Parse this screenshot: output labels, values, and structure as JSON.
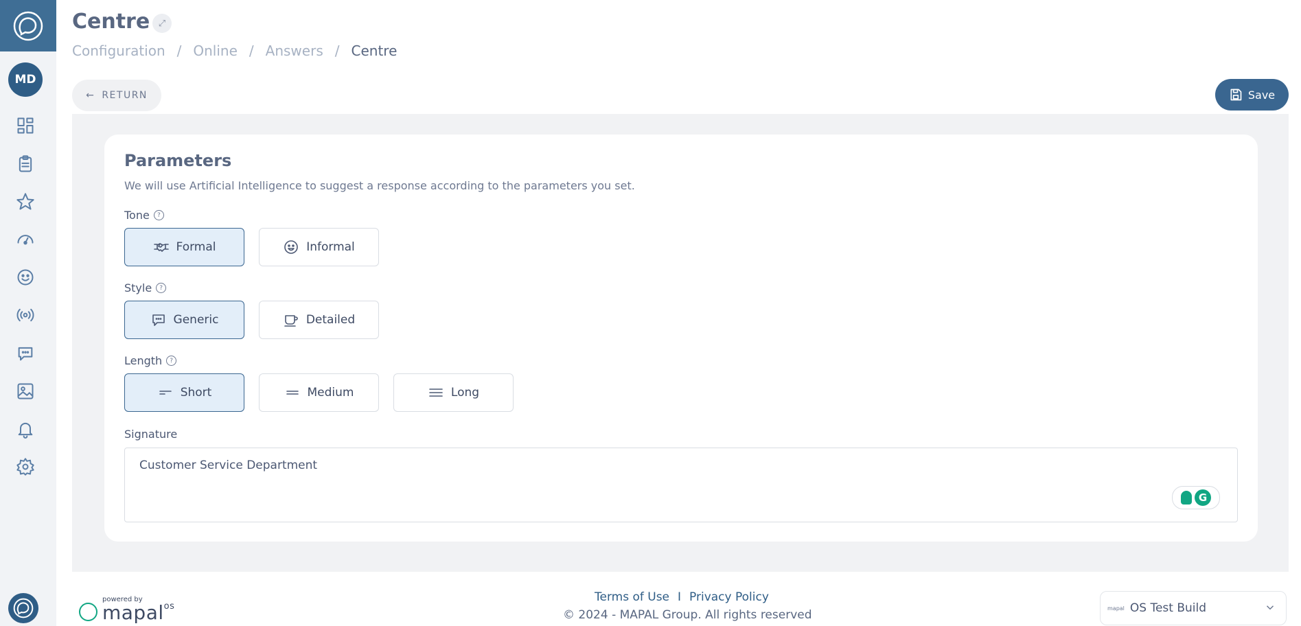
{
  "header": {
    "title": "Centre",
    "expand_icon": "expand-icon",
    "breadcrumb": [
      "Configuration",
      "Online",
      "Answers",
      "Centre"
    ],
    "breadcrumb_separator": "/"
  },
  "sidebar": {
    "avatar_initials": "MD",
    "items": [
      {
        "icon": "dashboard-icon"
      },
      {
        "icon": "clipboard-icon"
      },
      {
        "icon": "star-icon"
      },
      {
        "icon": "gauge-icon"
      },
      {
        "icon": "smiley-icon"
      },
      {
        "icon": "broadcast-icon"
      },
      {
        "icon": "chat-icon"
      },
      {
        "icon": "image-icon"
      },
      {
        "icon": "bell-icon"
      },
      {
        "icon": "gear-icon"
      }
    ]
  },
  "toolbar": {
    "return_label": "RETURN",
    "save_label": "Save"
  },
  "parameters": {
    "title": "Parameters",
    "description": "We will use Artificial Intelligence to suggest a response according to the parameters you set.",
    "tone": {
      "label": "Tone",
      "options": [
        {
          "label": "Formal",
          "icon": "handshake-icon",
          "selected": true
        },
        {
          "label": "Informal",
          "icon": "smiley-icon",
          "selected": false
        }
      ]
    },
    "style": {
      "label": "Style",
      "options": [
        {
          "label": "Generic",
          "icon": "chat-icon",
          "selected": true
        },
        {
          "label": "Detailed",
          "icon": "cup-icon",
          "selected": false
        }
      ]
    },
    "length": {
      "label": "Length",
      "options": [
        {
          "label": "Short",
          "icon": "short-lines-icon",
          "selected": true
        },
        {
          "label": "Medium",
          "icon": "medium-lines-icon",
          "selected": false
        },
        {
          "label": "Long",
          "icon": "long-lines-icon",
          "selected": false
        }
      ]
    },
    "signature": {
      "label": "Signature",
      "value": "Customer Service Department"
    }
  },
  "footer": {
    "powered_by": "powered by",
    "brand": "mapal",
    "brand_suffix": "os",
    "terms": "Terms of Use",
    "divider": "I",
    "privacy": "Privacy Policy",
    "copyright": "© 2024 - MAPAL Group. All rights reserved",
    "build_mini_logo": "mapal",
    "build_select_value": "OS Test Build"
  },
  "colors": {
    "brand": "#3f6e95",
    "accent": "#3a6690",
    "selected_bg": "#e3eef9",
    "grammarly": "#11a683"
  }
}
